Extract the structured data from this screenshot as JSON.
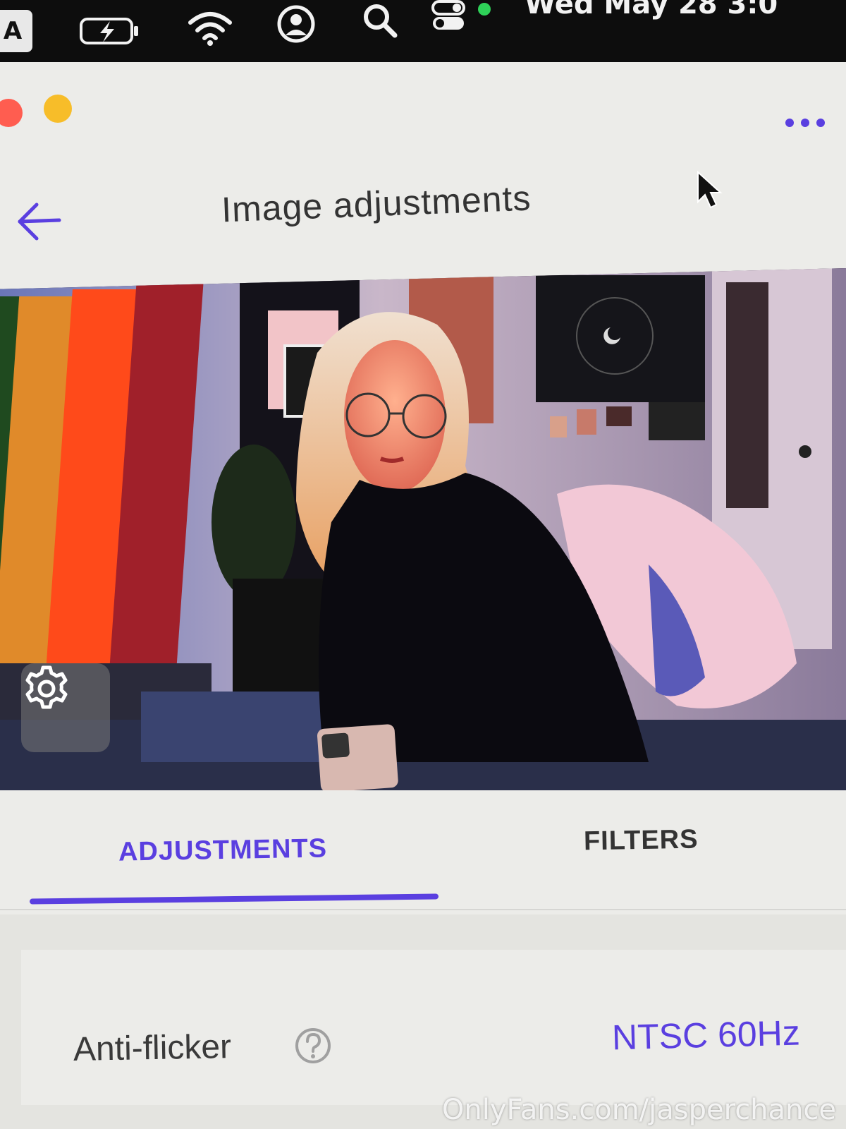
{
  "menubar": {
    "input_source": "A",
    "icons": [
      "battery-charging-icon",
      "wifi-icon",
      "user-account-icon",
      "spotlight-search-icon",
      "control-center-icon"
    ],
    "clock": "Wed May 28  3:0"
  },
  "window": {
    "more_menu": "more-options-icon"
  },
  "header": {
    "title": "Image adjustments",
    "back_icon": "back-arrow-icon"
  },
  "preview": {
    "settings_icon": "gear-icon"
  },
  "tabs": [
    {
      "label": "ADJUSTMENTS",
      "active": true
    },
    {
      "label": "FILTERS",
      "active": false
    }
  ],
  "settings": {
    "anti_flicker": {
      "label": "Anti-flicker",
      "value": "NTSC 60Hz",
      "help_icon": "question-circle-icon"
    }
  },
  "watermark": "OnlyFans.com/jasperchance",
  "colors": {
    "accent": "#5a3fe0",
    "background": "#ecece9",
    "text": "#333333",
    "menubar": "#0d0d0d"
  }
}
